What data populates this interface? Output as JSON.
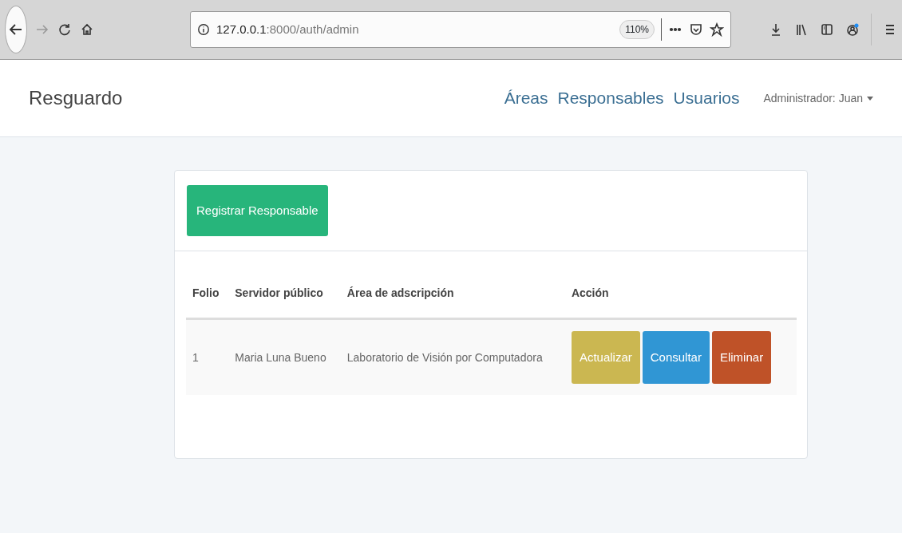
{
  "browser": {
    "url_host": "127.0.0.1",
    "url_path": ":8000/auth/admin",
    "zoom": "110%"
  },
  "navbar": {
    "brand": "Resguardo",
    "links": [
      "Áreas",
      "Responsables",
      "Usuarios"
    ],
    "user": "Administrador: Juan"
  },
  "panel": {
    "register_button": "Registrar Responsable",
    "table": {
      "columns": [
        "Folio",
        "Servidor público",
        "Área de adscripción",
        "Acción"
      ],
      "rows": [
        {
          "cells": [
            "1",
            "Maria Luna Bueno",
            "Laboratorio de Visión por Computadora"
          ],
          "actions": [
            {
              "label": "Actualizar",
              "kind": "update"
            },
            {
              "label": "Consultar",
              "kind": "view"
            },
            {
              "label": "Eliminar",
              "kind": "delete"
            }
          ]
        }
      ]
    }
  }
}
